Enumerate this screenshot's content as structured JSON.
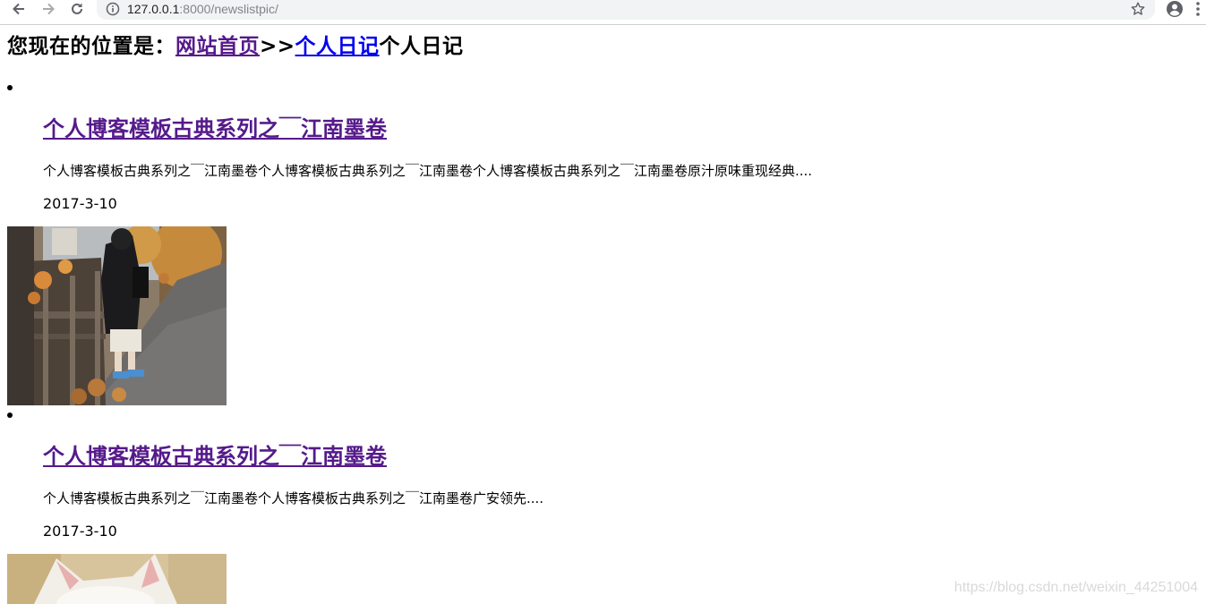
{
  "browser": {
    "url_host": "127.0.0.1",
    "url_path": ":8000/newslistpic/",
    "icons": {
      "back": "back-arrow-icon",
      "forward": "forward-arrow-icon",
      "reload": "reload-icon",
      "info": "info-icon",
      "bookmark": "star-icon",
      "profile": "profile-icon",
      "menu": "more-vert-icon"
    }
  },
  "breadcrumb": {
    "prefix": "您现在的位置是：",
    "home_link": "网站首页",
    "separator": ">>",
    "category_link": "个人日记",
    "current": "个人日记"
  },
  "articles": [
    {
      "title": "个人博客模板古典系列之￣江南墨卷",
      "summary": "个人博客模板古典系列之￣江南墨卷个人博客模板古典系列之￣江南墨卷个人博客模板古典系列之￣江南墨卷原汁原味重现经典....",
      "date": "2017-3-10",
      "image": "autumn-boardwalk-photo"
    },
    {
      "title": "个人博客模板古典系列之￣江南墨卷",
      "summary": "个人博客模板古典系列之￣江南墨卷个人博客模板古典系列之￣江南墨卷广安领先....",
      "date": "2017-3-10",
      "image": "white-cat-photo"
    }
  ],
  "watermark": "https://blog.csdn.net/weixin_44251004",
  "colors": {
    "visited_link": "#551a8b",
    "unvisited_link": "#0000ee",
    "omnibox_bg": "#f1f3f4"
  }
}
